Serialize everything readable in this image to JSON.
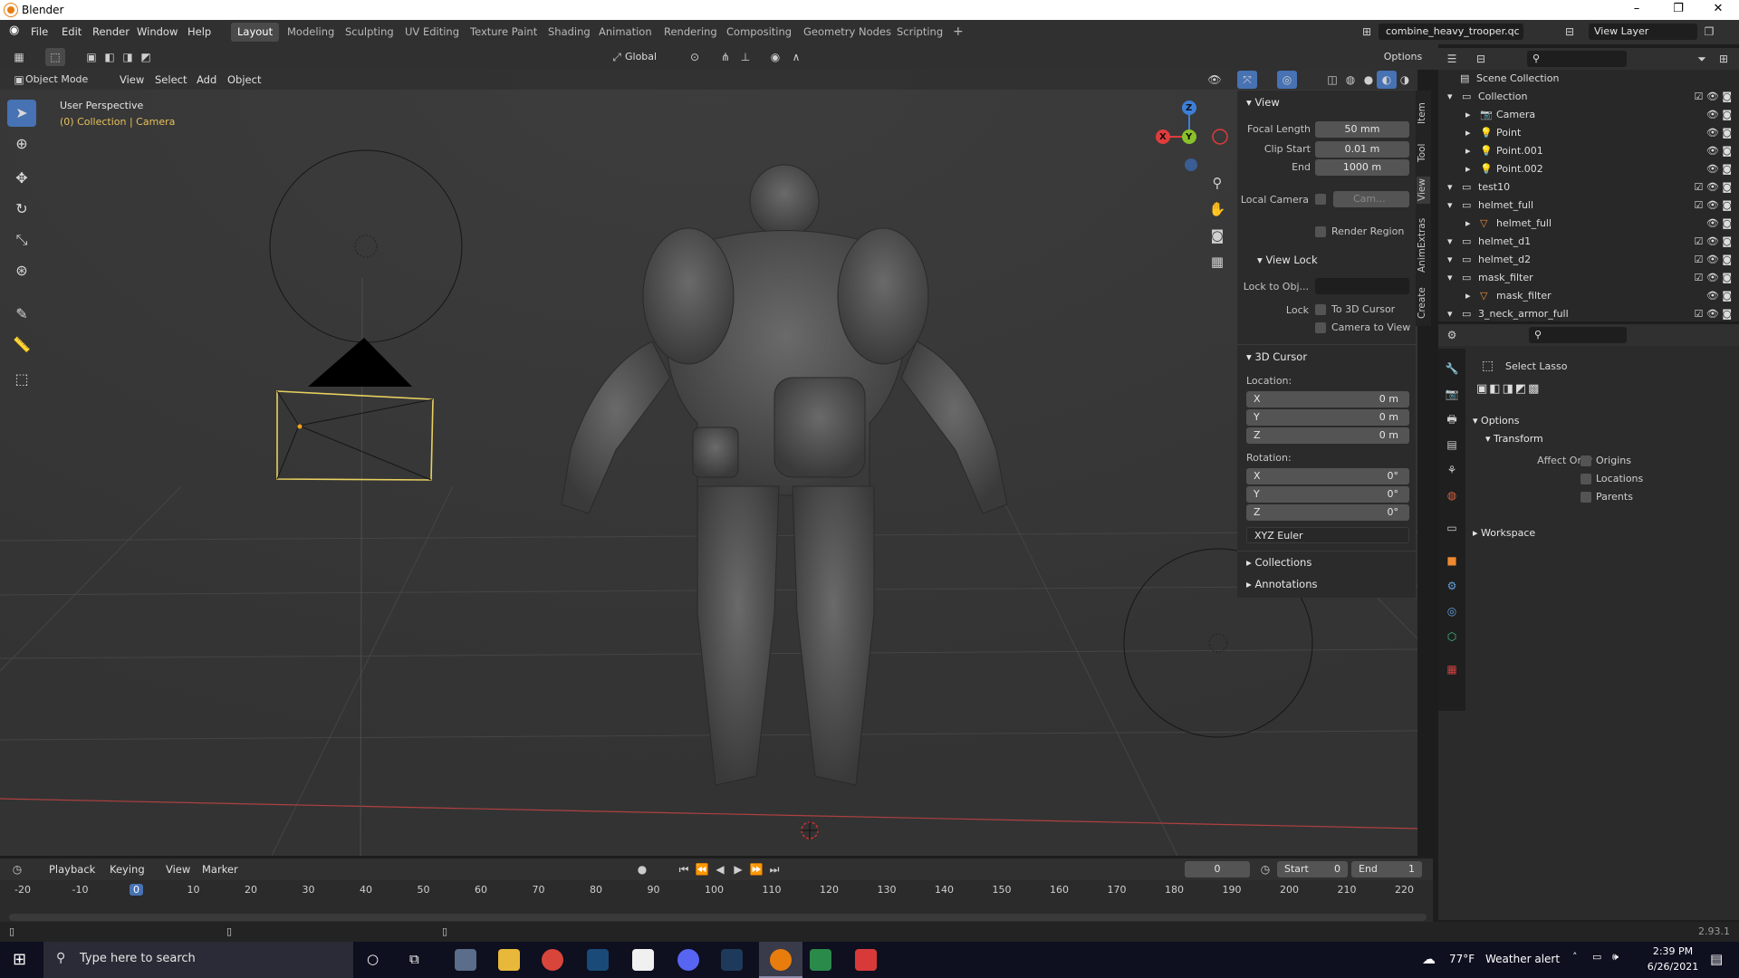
{
  "window": {
    "title": "Blender",
    "controls": [
      "–",
      "❐",
      "✕"
    ]
  },
  "menu": [
    "File",
    "Edit",
    "Render",
    "Window",
    "Help"
  ],
  "workspaces": [
    "Layout",
    "Modeling",
    "Sculpting",
    "UV Editing",
    "Texture Paint",
    "Shading",
    "Animation",
    "Rendering",
    "Compositing",
    "Geometry Nodes",
    "Scripting"
  ],
  "scene_name": "combine_heavy_trooper.qc",
  "view_layer": "View Layer",
  "header": {
    "transform_orientation": "Global",
    "options": "Options"
  },
  "viewport": {
    "mode": "Object Mode",
    "menus": [
      "View",
      "Select",
      "Add",
      "Object"
    ],
    "overlay_title": "User Perspective",
    "overlay_subtitle": "(0) Collection | Camera",
    "gizmo": {
      "x": "X",
      "y": "Y",
      "z": "Z"
    }
  },
  "npanel": {
    "view_header": "View",
    "focal_length_label": "Focal Length",
    "focal_length": "50 mm",
    "clip_start_label": "Clip Start",
    "clip_start": "0.01 m",
    "end_label": "End",
    "end": "1000 m",
    "local_camera_label": "Local Camera",
    "local_camera_value": "Cam...",
    "render_region": "Render Region",
    "view_lock_header": "View Lock",
    "lock_to_obj": "Lock to Obj...",
    "lock_label": "Lock",
    "to_3d_cursor": "To 3D Cursor",
    "camera_to_view": "Camera to View",
    "cursor_header": "3D Cursor",
    "location_label": "Location:",
    "location": [
      {
        "axis": "X",
        "value": "0 m"
      },
      {
        "axis": "Y",
        "value": "0 m"
      },
      {
        "axis": "Z",
        "value": "0 m"
      }
    ],
    "rotation_label": "Rotation:",
    "rotation": [
      {
        "axis": "X",
        "value": "0°"
      },
      {
        "axis": "Y",
        "value": "0°"
      },
      {
        "axis": "Z",
        "value": "0°"
      }
    ],
    "rotation_mode": "XYZ Euler",
    "collections": "Collections",
    "annotations": "Annotations"
  },
  "side_tabs": [
    "Item",
    "Tool",
    "View",
    "AnimExtras",
    "Create"
  ],
  "outliner": {
    "root": "Scene Collection",
    "rows": [
      {
        "name": "Collection",
        "indent": 1,
        "icon": "collection",
        "checked": true
      },
      {
        "name": "Camera",
        "indent": 2,
        "icon": "camera",
        "checked": false
      },
      {
        "name": "Point",
        "indent": 2,
        "icon": "light",
        "checked": false
      },
      {
        "name": "Point.001",
        "indent": 2,
        "icon": "light",
        "checked": false
      },
      {
        "name": "Point.002",
        "indent": 2,
        "icon": "light",
        "checked": false
      },
      {
        "name": "test10",
        "indent": 1,
        "icon": "collection",
        "checked": true
      },
      {
        "name": "helmet_full",
        "indent": 1,
        "icon": "collection",
        "checked": true
      },
      {
        "name": "helmet_full",
        "indent": 2,
        "icon": "mesh",
        "checked": false
      },
      {
        "name": "helmet_d1",
        "indent": 1,
        "icon": "collection",
        "checked": true
      },
      {
        "name": "helmet_d2",
        "indent": 1,
        "icon": "collection",
        "checked": true
      },
      {
        "name": "mask_filter",
        "indent": 1,
        "icon": "collection",
        "checked": true
      },
      {
        "name": "mask_filter",
        "indent": 2,
        "icon": "mesh",
        "checked": false
      },
      {
        "name": "3_neck_armor_full",
        "indent": 1,
        "icon": "collection",
        "checked": true
      }
    ]
  },
  "properties": {
    "tool_name": "Select Lasso",
    "options_header": "Options",
    "transform_header": "Transform",
    "affect_only_label": "Affect Only",
    "affect_only": [
      "Origins",
      "Locations",
      "Parents"
    ],
    "workspace_header": "Workspace"
  },
  "timeline": {
    "menus": [
      "Playback",
      "Keying",
      "View",
      "Marker"
    ],
    "current_frame": "0",
    "start_label": "Start",
    "start": "0",
    "end_label": "End",
    "end": "1",
    "ruler": [
      "-20",
      "-10",
      "0",
      "10",
      "20",
      "30",
      "40",
      "50",
      "60",
      "70",
      "80",
      "90",
      "100",
      "110",
      "120",
      "130",
      "140",
      "150",
      "160",
      "170",
      "180",
      "190",
      "200",
      "210",
      "220"
    ]
  },
  "status": {
    "version": "2.93.1"
  },
  "taskbar": {
    "search_placeholder": "Type here to search",
    "temperature": "77°F",
    "weather": "Weather alert",
    "time": "2:39 PM",
    "date": "6/26/2021"
  },
  "colors": {
    "accent": "#4772b3",
    "selected_outline": "#f0d060",
    "x_axis": "#e03c3c",
    "y_axis": "#8ac02a",
    "z_axis": "#3d7fd8"
  }
}
